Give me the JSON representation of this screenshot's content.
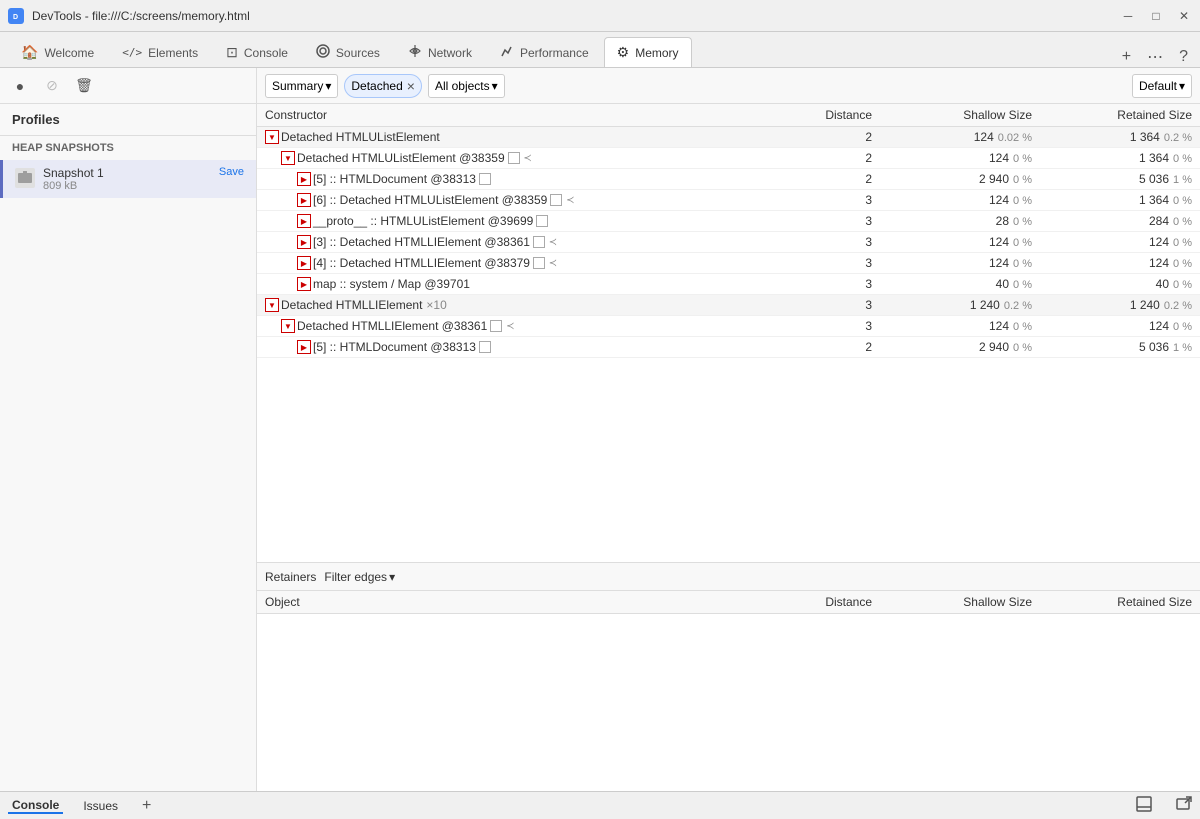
{
  "titleBar": {
    "icon": "devtools-icon",
    "title": "DevTools - file:///C:/screens/memory.html",
    "controls": [
      "minimize",
      "maximize",
      "close"
    ]
  },
  "tabs": [
    {
      "id": "welcome",
      "label": "Welcome",
      "icon": "🏠",
      "active": false
    },
    {
      "id": "elements",
      "label": "Elements",
      "icon": "</>",
      "active": false
    },
    {
      "id": "console",
      "label": "Console",
      "icon": "⊡",
      "active": false
    },
    {
      "id": "sources",
      "label": "Sources",
      "icon": "⊞",
      "active": false
    },
    {
      "id": "network",
      "label": "Network",
      "icon": "◎",
      "active": false
    },
    {
      "id": "performance",
      "label": "Performance",
      "icon": "⊛",
      "active": false
    },
    {
      "id": "memory",
      "label": "Memory",
      "icon": "⚙",
      "active": true
    }
  ],
  "sidebar": {
    "profilesLabel": "Profiles",
    "heapLabel": "HEAP SNAPSHOTS",
    "snapshot": {
      "name": "Snapshot 1",
      "size": "809 kB",
      "saveLabel": "Save"
    },
    "tools": {
      "record": "●",
      "stop": "⊘",
      "clear": "🗑"
    }
  },
  "toolbar": {
    "summary": "Summary",
    "viewMode": "Detached",
    "filterClear": "×",
    "allObjects": "All objects",
    "sortOrder": "Default"
  },
  "tableHeaders": {
    "constructor": "Constructor",
    "distance": "Distance",
    "shallowSize": "Shallow Size",
    "retainedSize": "Retained Size"
  },
  "rows": [
    {
      "id": "row1",
      "indent": 0,
      "expandable": true,
      "expanded": true,
      "toggle": "▼",
      "label": "Detached HTMLUListElement",
      "addr": "",
      "ref": "",
      "boxes": 0,
      "distance": "2",
      "shallow": "124",
      "shallowPct": "0.02 %",
      "retained": "1 364",
      "retainedPct": "0.2 %"
    },
    {
      "id": "row2",
      "indent": 1,
      "expandable": true,
      "expanded": true,
      "toggle": "▼",
      "label": "Detached HTMLUListElement",
      "addr": "@38359",
      "ref": "",
      "boxes": 2,
      "distance": "2",
      "shallow": "124",
      "shallowPct": "0 %",
      "retained": "1 364",
      "retainedPct": "0 %"
    },
    {
      "id": "row3",
      "indent": 2,
      "expandable": true,
      "expanded": false,
      "toggle": "▶",
      "label": "[5] :: HTMLDocument",
      "addr": "@38313",
      "ref": "",
      "boxes": 1,
      "distance": "2",
      "shallow": "2 940",
      "shallowPct": "0 %",
      "retained": "5 036",
      "retainedPct": "1 %"
    },
    {
      "id": "row4",
      "indent": 2,
      "expandable": true,
      "expanded": false,
      "toggle": "▶",
      "label": "[6] :: Detached HTMLUListElement",
      "addr": "@38359",
      "ref": "",
      "boxes": 2,
      "distance": "3",
      "shallow": "124",
      "shallowPct": "0 %",
      "retained": "1 364",
      "retainedPct": "0 %"
    },
    {
      "id": "row5",
      "indent": 2,
      "expandable": true,
      "expanded": false,
      "toggle": "▶",
      "label": "__proto__ :: HTMLUListElement",
      "addr": "@39699",
      "ref": "",
      "boxes": 1,
      "distance": "3",
      "shallow": "28",
      "shallowPct": "0 %",
      "retained": "284",
      "retainedPct": "0 %"
    },
    {
      "id": "row6",
      "indent": 2,
      "expandable": true,
      "expanded": false,
      "toggle": "▶",
      "label": "[3] :: Detached HTMLLIElement",
      "addr": "@38361",
      "ref": "",
      "boxes": 2,
      "distance": "3",
      "shallow": "124",
      "shallowPct": "0 %",
      "retained": "124",
      "retainedPct": "0 %"
    },
    {
      "id": "row7",
      "indent": 2,
      "expandable": true,
      "expanded": false,
      "toggle": "▶",
      "label": "[4] :: Detached HTMLLIElement",
      "addr": "@38379",
      "ref": "",
      "boxes": 2,
      "distance": "3",
      "shallow": "124",
      "shallowPct": "0 %",
      "retained": "124",
      "retainedPct": "0 %"
    },
    {
      "id": "row8",
      "indent": 2,
      "expandable": true,
      "expanded": false,
      "toggle": "▶",
      "label": "map :: system / Map",
      "addr": "@39701",
      "ref": "",
      "boxes": 0,
      "distance": "3",
      "shallow": "40",
      "shallowPct": "0 %",
      "retained": "40",
      "retainedPct": "0 %"
    },
    {
      "id": "row9",
      "indent": 0,
      "expandable": true,
      "expanded": true,
      "toggle": "▼",
      "label": "Detached HTMLLIElement",
      "addr": "",
      "ref": "×10",
      "boxes": 0,
      "distance": "3",
      "shallow": "1 240",
      "shallowPct": "0.2 %",
      "retained": "1 240",
      "retainedPct": "0.2 %"
    },
    {
      "id": "row10",
      "indent": 1,
      "expandable": true,
      "expanded": true,
      "toggle": "▼",
      "label": "Detached HTMLLIElement",
      "addr": "@38361",
      "ref": "",
      "boxes": 2,
      "distance": "3",
      "shallow": "124",
      "shallowPct": "0 %",
      "retained": "124",
      "retainedPct": "0 %"
    },
    {
      "id": "row11",
      "indent": 2,
      "expandable": true,
      "expanded": false,
      "toggle": "▶",
      "label": "[5] :: HTMLDocument",
      "addr": "@38313",
      "ref": "",
      "boxes": 1,
      "distance": "2",
      "shallow": "2 940",
      "shallowPct": "0 %",
      "retained": "5 036",
      "retainedPct": "1 %"
    }
  ],
  "retainersSection": {
    "label": "Retainers",
    "filterEdges": "Filter edges",
    "headers": {
      "object": "Object",
      "distance": "Distance",
      "shallowSize": "Shallow Size",
      "retainedSize": "Retained Size"
    },
    "rows": []
  },
  "bottomBar": {
    "tabs": [
      "Console",
      "Issues"
    ],
    "activeTab": "Console"
  }
}
